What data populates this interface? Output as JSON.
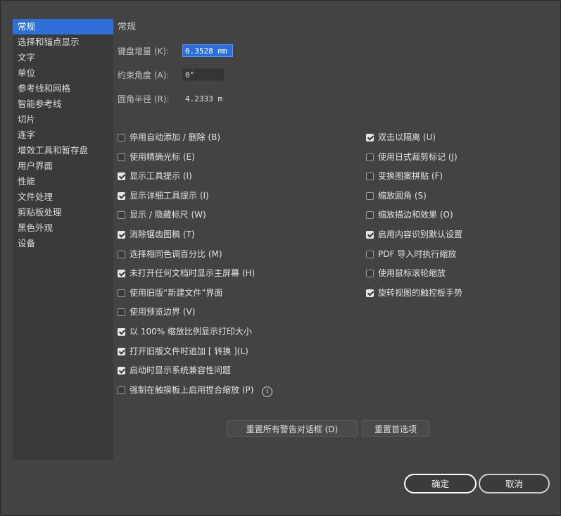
{
  "sidebar": {
    "items": [
      {
        "label": "常规",
        "active": true
      },
      {
        "label": "选择和锚点显示",
        "active": false
      },
      {
        "label": "文字",
        "active": false
      },
      {
        "label": "单位",
        "active": false
      },
      {
        "label": "参考线和网格",
        "active": false
      },
      {
        "label": "智能参考线",
        "active": false
      },
      {
        "label": "切片",
        "active": false
      },
      {
        "label": "连字",
        "active": false
      },
      {
        "label": "增效工具和暂存盘",
        "active": false
      },
      {
        "label": "用户界面",
        "active": false
      },
      {
        "label": "性能",
        "active": false
      },
      {
        "label": "文件处理",
        "active": false
      },
      {
        "label": "剪贴板处理",
        "active": false
      },
      {
        "label": "黑色外观",
        "active": false
      },
      {
        "label": "设备",
        "active": false
      }
    ]
  },
  "main": {
    "section_title": "常规",
    "fields": {
      "keyboard_increment": {
        "label": "键盘增量 (K):",
        "value": "0.3528 mm"
      },
      "constrain_angle": {
        "label": "约束角度 (A):",
        "value": "0°"
      },
      "corner_radius": {
        "label": "圆角半径 (R):",
        "value": "4.2333 m"
      }
    },
    "left_options": [
      {
        "label": "停用自动添加 / 删除 (B)",
        "checked": false
      },
      {
        "label": "使用精确光标 (E)",
        "checked": false
      },
      {
        "label": "显示工具提示 (I)",
        "checked": true
      },
      {
        "label": "显示详细工具提示 (I)",
        "checked": true
      },
      {
        "label": "显示 / 隐藏标尺 (W)",
        "checked": false
      },
      {
        "label": "消除锯齿图稿 (T)",
        "checked": true
      },
      {
        "label": "选择相同色调百分比 (M)",
        "checked": false
      },
      {
        "label": "未打开任何文档时显示主屏幕 (H)",
        "checked": true
      },
      {
        "label": "使用旧版“新建文件”界面",
        "checked": false
      },
      {
        "label": "使用预览边界 (V)",
        "checked": false
      },
      {
        "label": "以 100% 缩放比例显示打印大小",
        "checked": true
      },
      {
        "label": "打开旧版文件时追加 [ 转换 ](L)",
        "checked": true
      },
      {
        "label": "启动时显示系统兼容性问题",
        "checked": true
      },
      {
        "label": "强制在触摸板上启用捏合缩放 (P)",
        "checked": false
      }
    ],
    "right_options": [
      {
        "label": "双击以隔离 (U)",
        "checked": true
      },
      {
        "label": "使用日式裁剪标记 (J)",
        "checked": false
      },
      {
        "label": "变换图案拼贴 (F)",
        "checked": false
      },
      {
        "label": "缩放圆角 (S)",
        "checked": false
      },
      {
        "label": "缩放描边和效果 (O)",
        "checked": false
      },
      {
        "label": "启用内容识别默认设置",
        "checked": true
      },
      {
        "label": "PDF 导入时执行缩放",
        "checked": false
      },
      {
        "label": "使用鼠标滚轮缩放",
        "checked": false
      },
      {
        "label": "旋转视图的触控板手势",
        "checked": true
      }
    ],
    "info_icon": "info-icon",
    "buttons": {
      "reset_warnings": "重置所有警告对话框 (D)",
      "reset_prefs": "重置首选项"
    }
  },
  "footer": {
    "ok_label": "确定",
    "cancel_label": "取消"
  }
}
